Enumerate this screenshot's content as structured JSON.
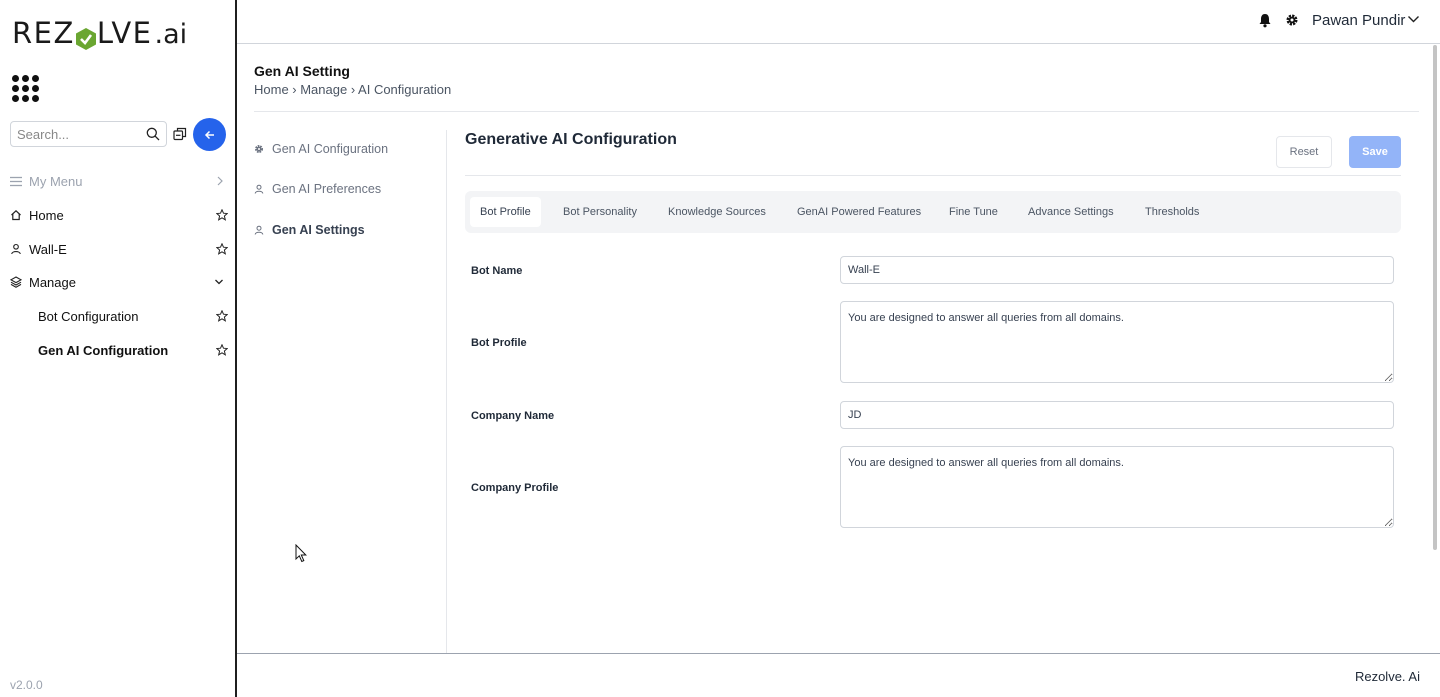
{
  "brand": {
    "logo_prefix": "REZ",
    "logo_suffix": "LVE",
    "logo_ai": ".ai",
    "logo_check_color": "#6aa631"
  },
  "sidebar": {
    "search_placeholder": "Search...",
    "my_menu_label": "My Menu",
    "items": [
      {
        "label": "Home",
        "icon": "home-icon"
      },
      {
        "label": "Wall-E",
        "icon": "user-icon"
      },
      {
        "label": "Manage",
        "icon": "layers-icon"
      }
    ],
    "sub_items": [
      {
        "label": "Bot Configuration"
      },
      {
        "label": "Gen AI Configuration"
      }
    ],
    "version": "v2.0.0"
  },
  "topbar": {
    "user_name": "Pawan Pundir"
  },
  "page": {
    "title": "Gen AI Setting",
    "breadcrumb": "Home › Manage › AI Configuration"
  },
  "left_nav": [
    {
      "label": "Gen AI Configuration",
      "icon": "gear-icon"
    },
    {
      "label": "Gen AI Preferences",
      "icon": "user-icon"
    },
    {
      "label": "Gen AI Settings",
      "icon": "user-icon"
    }
  ],
  "section": {
    "title": "Generative AI Configuration",
    "reset_label": "Reset",
    "save_label": "Save"
  },
  "tabs": [
    "Bot Profile",
    "Bot Personality",
    "Knowledge Sources",
    "GenAI Powered Features",
    "Fine Tune",
    "Advance Settings",
    "Thresholds"
  ],
  "form": {
    "bot_name_label": "Bot Name",
    "bot_name_value": "Wall-E",
    "bot_profile_label": "Bot Profile",
    "bot_profile_value": "You are designed to answer all queries from all domains.",
    "company_name_label": "Company Name",
    "company_name_value": "JD",
    "company_profile_label": "Company Profile",
    "company_profile_value": "You are designed to answer all queries from all domains."
  },
  "footer": {
    "text": "Rezolve. Ai"
  },
  "colors": {
    "accent": "#2563eb",
    "save_disabled": "#93b4f8"
  }
}
